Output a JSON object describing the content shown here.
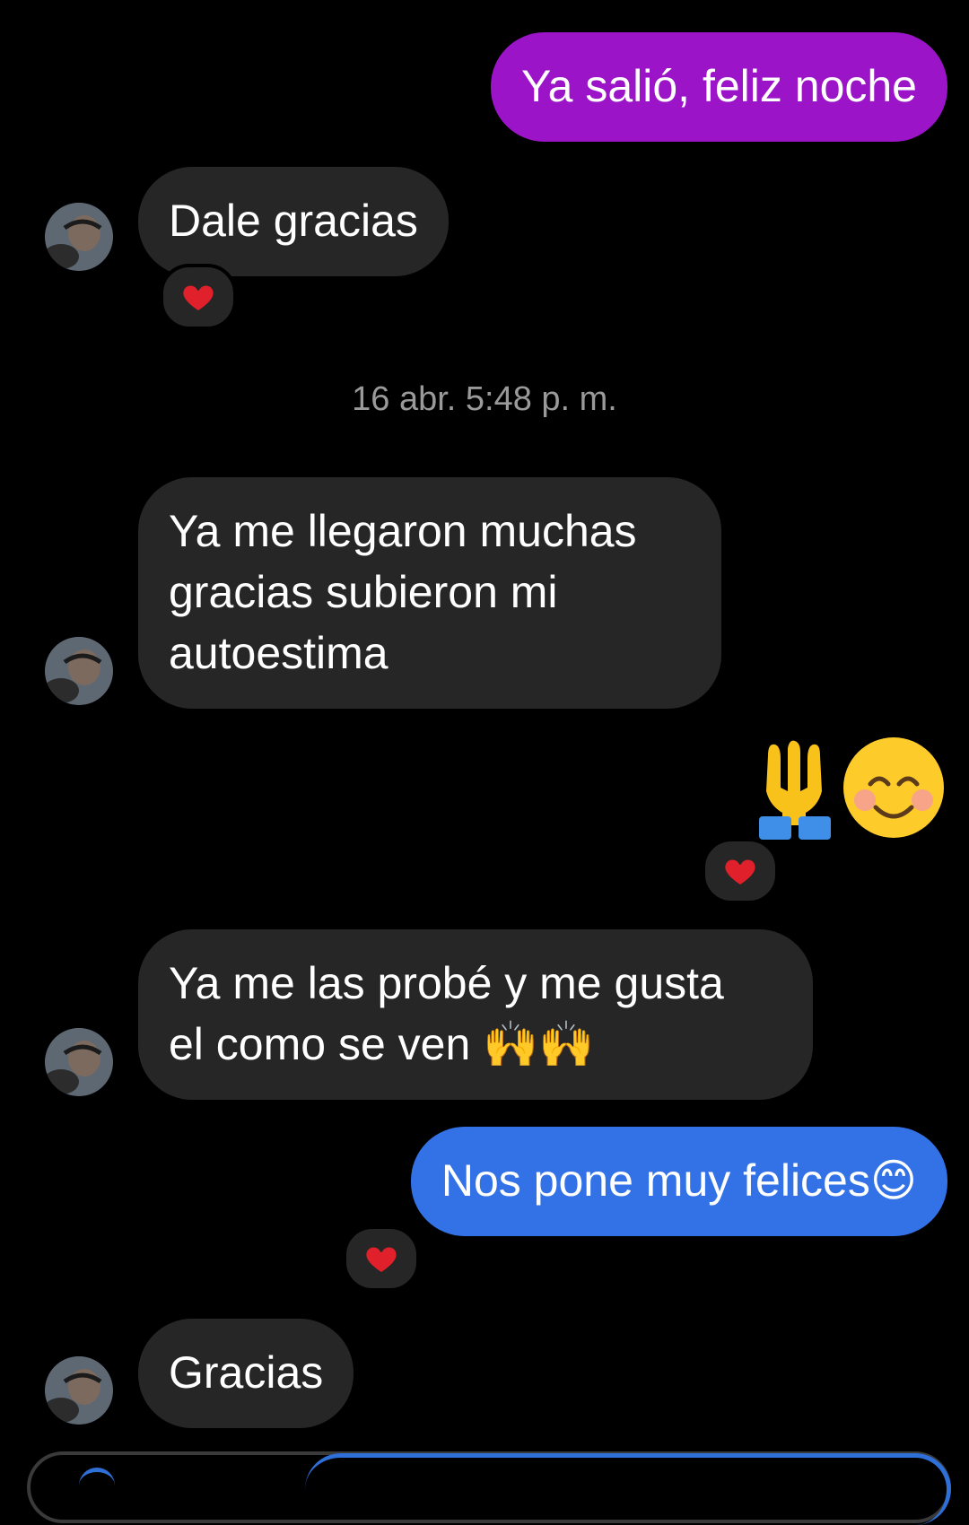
{
  "messages": [
    {
      "id": "m1",
      "direction": "outgoing",
      "text": "Ya salió, feliz noche"
    },
    {
      "id": "m2",
      "direction": "incoming",
      "text": "Dale gracias",
      "reaction": "heart"
    },
    {
      "id": "m3",
      "direction": "incoming",
      "text": "Ya me llegaron muchas\ngracias subieron mi\nautoestima"
    },
    {
      "id": "m4",
      "direction": "outgoing",
      "emojis": [
        "folded-hands",
        "smiling-face"
      ],
      "reaction": "heart"
    },
    {
      "id": "m5",
      "direction": "incoming",
      "text": "Ya me las probé y me gusta\nel como se ven 🙌🙌"
    },
    {
      "id": "m6",
      "direction": "outgoing",
      "text": "Nos pone muy felices😊",
      "reaction": "heart"
    },
    {
      "id": "m7",
      "direction": "incoming",
      "text": "Gracias"
    }
  ],
  "timestamp": "16 abr. 5:48 p. m.",
  "colors": {
    "background": "#000000",
    "incoming_bubble": "#262626",
    "outgoing_purple": "#9b14c8",
    "outgoing_blue": "#3372e6",
    "timestamp": "#9a9a9a",
    "reaction_heart": "#e0202a"
  }
}
